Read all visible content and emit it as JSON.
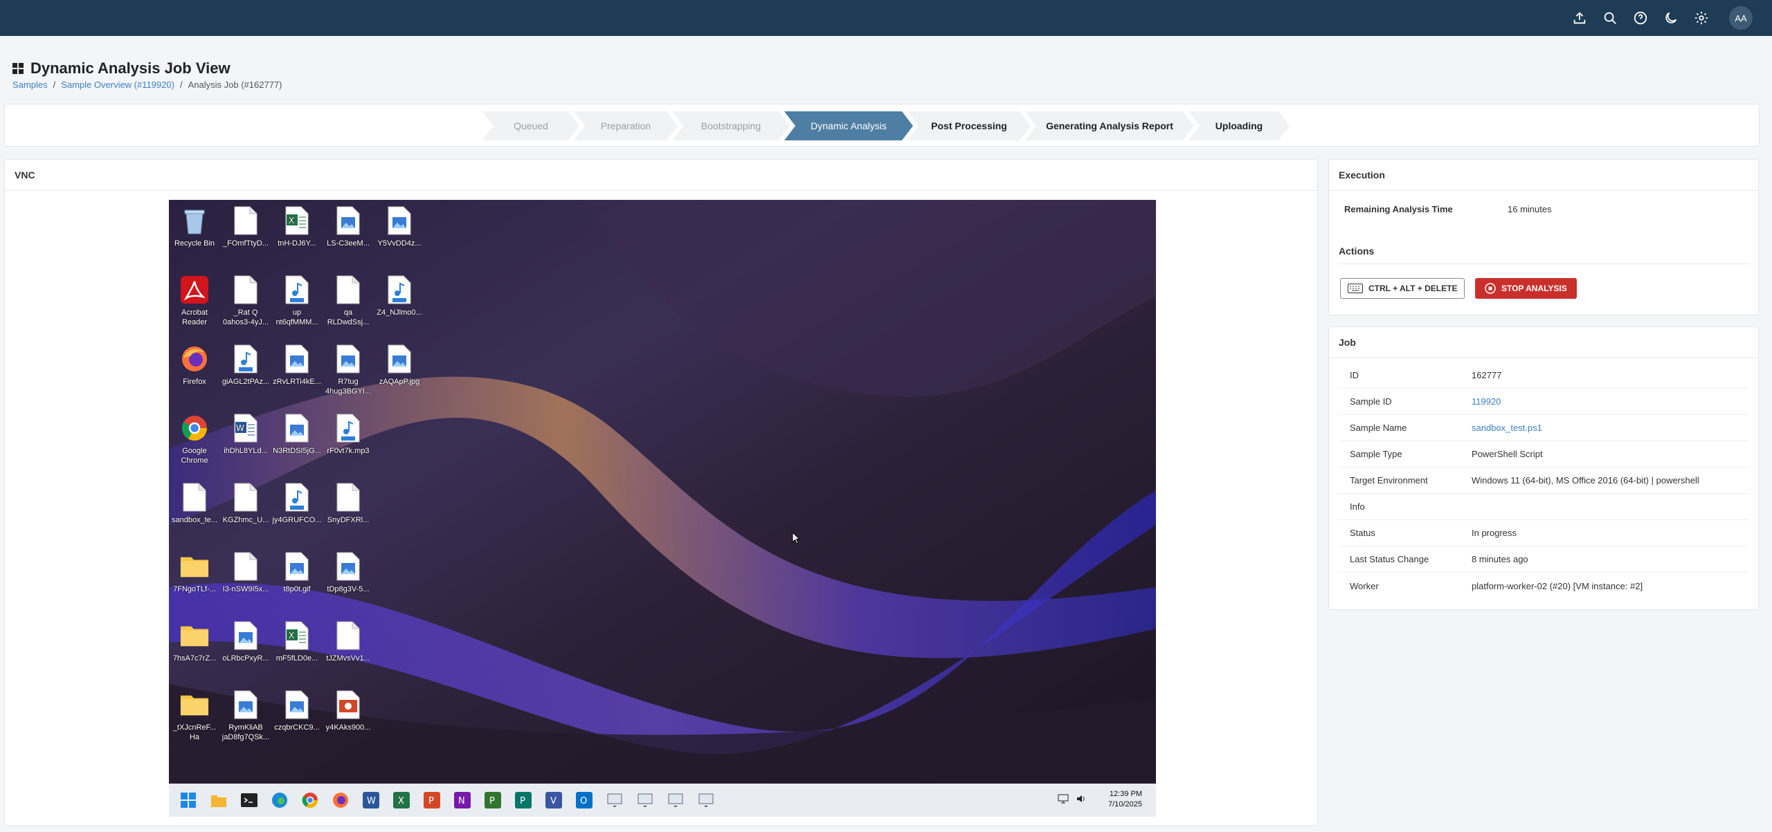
{
  "topbar": {
    "avatar": "AA"
  },
  "page": {
    "title": "Dynamic Analysis Job View"
  },
  "breadcrumb": {
    "samples": "Samples",
    "sep": "/",
    "overview": "Sample Overview (#119920)",
    "current": "Analysis Job (#162777)"
  },
  "steps": [
    "Queued",
    "Preparation",
    "Bootstrapping",
    "Dynamic Analysis",
    "Post Processing",
    "Generating Analysis Report",
    "Uploading"
  ],
  "vnc": {
    "title": "VNC",
    "desktop_icons": [
      "Recycle Bin",
      "_FOmfTtyD...",
      "tnH-DJ6Y...",
      "LS-C3eeM...",
      "Y5VvDD4z...",
      "Acrobat Reader",
      "_Rat Q 0ahos3-4yJ...",
      "up nt6qfMMM...",
      "qa RLDwdSsj...",
      "Z4_NJlmo0...",
      "Firefox",
      "giAGL2tPAz...",
      "zRvLRTi4kE...",
      "R7tug 4hug3BGYI...",
      "zAQApP.jpg",
      "Google Chrome",
      "ihDhL8YLd...",
      "N3RtDSI5jG...",
      "rF0vt7k.mp3",
      "sandbox_te...",
      "KGZhmc_U...",
      "jy4GRUFCO...",
      "SnyDFXRl...",
      "7FNgoTLf-...",
      "I3-nSW9I5x...",
      "t8p0t.gif",
      "tDp8g3V-5...",
      "7hsA7c7rZ...",
      "oLRbcPxyR...",
      "mF5fLD0e...",
      "tJZMvsVv1...",
      "_tXJcnReF... Ha",
      "RymKliAB jaD8fg7QSk...",
      "czqbrCKC9...",
      "y4KAks900..."
    ],
    "clock_time": "12:39 PM",
    "clock_date": "7/10/2025"
  },
  "execution": {
    "title": "Execution",
    "remaining_label": "Remaining Analysis Time",
    "remaining_value": "16 minutes",
    "actions_label": "Actions",
    "cad_label": "CTRL + ALT + DELETE",
    "stop_label": "STOP ANALYSIS"
  },
  "job": {
    "title": "Job",
    "rows": [
      {
        "k": "ID",
        "v": "162777"
      },
      {
        "k": "Sample ID",
        "v": "119920"
      },
      {
        "k": "Sample Name",
        "v": "sandbox_test.ps1"
      },
      {
        "k": "Sample Type",
        "v": "PowerShell Script"
      },
      {
        "k": "Target Environment",
        "v": "Windows 11 (64-bit), MS Office 2016 (64-bit) | powershell"
      },
      {
        "k": "Info",
        "v": ""
      },
      {
        "k": "Status",
        "v": "In progress"
      },
      {
        "k": "Last Status Change",
        "v": "8 minutes ago"
      },
      {
        "k": "Worker",
        "v": "platform-worker-02 (#20) [VM instance: #2]"
      }
    ]
  }
}
